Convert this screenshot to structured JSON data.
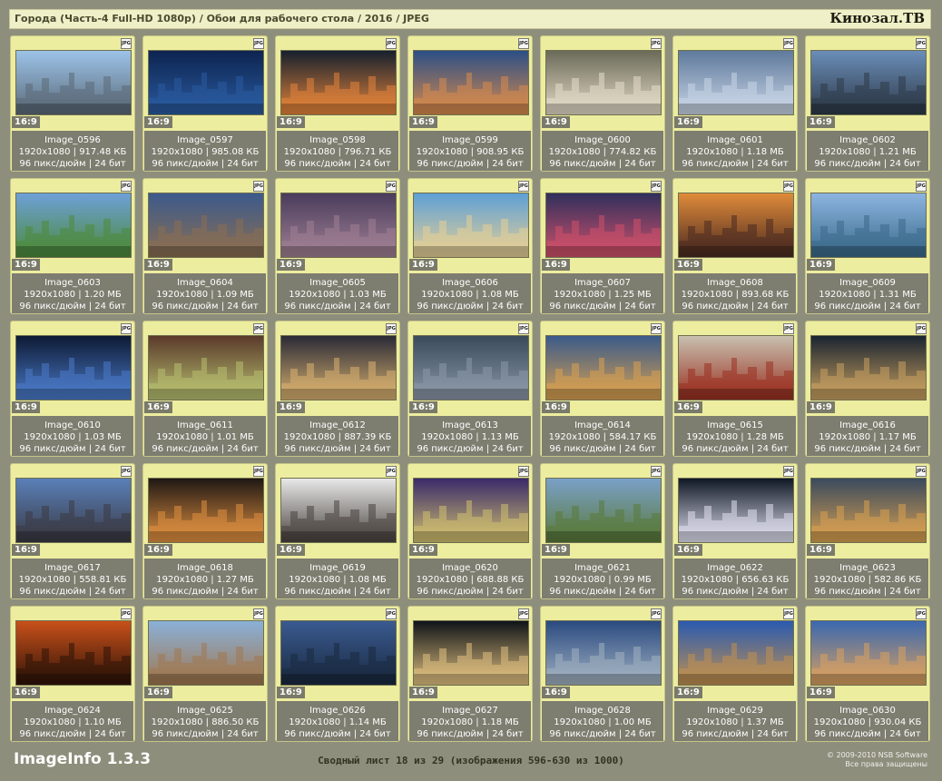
{
  "header": {
    "title": "Города (Часть-4 Full-HD 1080p) / Обои для рабочего стола / 2016 / JPEG",
    "brand": "Кинозал.ТВ"
  },
  "badge_label": "JPG",
  "images": [
    {
      "name": "Image_0596",
      "size": "1920x1080 | 917.48 КБ",
      "dpi": "96 пикс/дюйм | 24 бит",
      "ratio": "16:9",
      "scene": "tower-bridge",
      "colors": [
        "#9cc3e8",
        "#5b6a78"
      ]
    },
    {
      "name": "Image_0597",
      "size": "1920x1080 | 985.08 КБ",
      "dpi": "96 пикс/дюйм | 24 бит",
      "ratio": "16:9",
      "scene": "night-city",
      "colors": [
        "#0d2450",
        "#2a5ba0"
      ]
    },
    {
      "name": "Image_0598",
      "size": "1920x1080 | 796.71 КБ",
      "dpi": "96 пикс/дюйм | 24 бит",
      "ratio": "16:9",
      "scene": "night-bridge",
      "colors": [
        "#16202e",
        "#e4843a"
      ]
    },
    {
      "name": "Image_0599",
      "size": "1920x1080 | 908.95 КБ",
      "dpi": "96 пикс/дюйм | 24 бит",
      "ratio": "16:9",
      "scene": "dusk-skyline",
      "colors": [
        "#2b4f86",
        "#d78a4c"
      ]
    },
    {
      "name": "Image_0600",
      "size": "1920x1080 | 774.82 КБ",
      "dpi": "96 пикс/дюйм | 24 бит",
      "ratio": "16:9",
      "scene": "taj-mahal",
      "colors": [
        "#6b6a58",
        "#e4dcc8"
      ]
    },
    {
      "name": "Image_0601",
      "size": "1920x1080 | 1.18 МБ",
      "dpi": "96 пикс/дюйм | 24 бит",
      "ratio": "16:9",
      "scene": "harbor-bridge",
      "colors": [
        "#5f7a9c",
        "#c9d5e6"
      ]
    },
    {
      "name": "Image_0602",
      "size": "1920x1080 | 1.21 МБ",
      "dpi": "96 пикс/дюйм | 24 бит",
      "ratio": "16:9",
      "scene": "skyscrapers",
      "colors": [
        "#6a8db8",
        "#2e3a48"
      ]
    },
    {
      "name": "Image_0603",
      "size": "1920x1080 | 1.20 МБ",
      "dpi": "96 пикс/дюйм | 24 бит",
      "ratio": "16:9",
      "scene": "lake-city",
      "colors": [
        "#6ea0d8",
        "#4c8a3a"
      ]
    },
    {
      "name": "Image_0604",
      "size": "1920x1080 | 1.09 МБ",
      "dpi": "96 пикс/дюйм | 24 бит",
      "ratio": "16:9",
      "scene": "bay-mountains",
      "colors": [
        "#3c5a8c",
        "#8a6e52"
      ]
    },
    {
      "name": "Image_0605",
      "size": "1920x1080 | 1.03 МБ",
      "dpi": "96 пикс/дюйм | 24 бит",
      "ratio": "16:9",
      "scene": "purple-skyline",
      "colors": [
        "#4a3c5c",
        "#a08094"
      ]
    },
    {
      "name": "Image_0606",
      "size": "1920x1080 | 1.08 МБ",
      "dpi": "96 пикс/дюйм | 24 бит",
      "ratio": "16:9",
      "scene": "beach",
      "colors": [
        "#5ea0d6",
        "#e6cf96"
      ]
    },
    {
      "name": "Image_0607",
      "size": "1920x1080 | 1.25 МБ",
      "dpi": "96 пикс/дюйм | 24 бит",
      "ratio": "16:9",
      "scene": "harbor-night",
      "colors": [
        "#30305c",
        "#d0506a"
      ]
    },
    {
      "name": "Image_0608",
      "size": "1920x1080 | 893.68 КБ",
      "dpi": "96 пикс/дюйм | 24 бит",
      "ratio": "16:9",
      "scene": "sunset-city",
      "colors": [
        "#e08b3a",
        "#4a2a20"
      ]
    },
    {
      "name": "Image_0609",
      "size": "1920x1080 | 1.31 МБ",
      "dpi": "96 пикс/дюйм | 24 бит",
      "ratio": "16:9",
      "scene": "waterfront",
      "colors": [
        "#8cb4e0",
        "#3a6a8a"
      ]
    },
    {
      "name": "Image_0610",
      "size": "1920x1080 | 1.03 МБ",
      "dpi": "96 пикс/дюйм | 24 бит",
      "ratio": "16:9",
      "scene": "night-bridge-blue",
      "colors": [
        "#0e1a34",
        "#4a7ac8"
      ]
    },
    {
      "name": "Image_0611",
      "size": "1920x1080 | 1.01 МБ",
      "dpi": "96 пикс/дюйм | 24 бит",
      "ratio": "16:9",
      "scene": "chinese-garden",
      "colors": [
        "#5a3a2a",
        "#b8c070"
      ]
    },
    {
      "name": "Image_0612",
      "size": "1920x1080 | 887.39 КБ",
      "dpi": "96 пикс/дюйм | 24 бит",
      "ratio": "16:9",
      "scene": "plaza-night",
      "colors": [
        "#2a2a36",
        "#d8b070"
      ]
    },
    {
      "name": "Image_0613",
      "size": "1920x1080 | 1.13 МБ",
      "dpi": "96 пикс/дюйм | 24 бит",
      "ratio": "16:9",
      "scene": "dark-towers",
      "colors": [
        "#3a4a5a",
        "#8a98a8"
      ]
    },
    {
      "name": "Image_0614",
      "size": "1920x1080 | 584.17 КБ",
      "dpi": "96 пикс/дюйм | 24 бит",
      "ratio": "16:9",
      "scene": "drawbridge",
      "colors": [
        "#3a5a8a",
        "#d8a050"
      ]
    },
    {
      "name": "Image_0615",
      "size": "1920x1080 | 1.28 МБ",
      "dpi": "96 пикс/дюйм | 24 бит",
      "ratio": "16:9",
      "scene": "cathedral",
      "colors": [
        "#c8c0b0",
        "#9a3020"
      ]
    },
    {
      "name": "Image_0616",
      "size": "1920x1080 | 1.17 МБ",
      "dpi": "96 пикс/дюйм | 24 бит",
      "ratio": "16:9",
      "scene": "aerial-night",
      "colors": [
        "#1a2430",
        "#c8a060"
      ]
    },
    {
      "name": "Image_0617",
      "size": "1920x1080 | 558.81 КБ",
      "dpi": "96 пикс/дюйм | 24 бит",
      "ratio": "16:9",
      "scene": "flatiron",
      "colors": [
        "#5a80b8",
        "#3a3a44"
      ]
    },
    {
      "name": "Image_0618",
      "size": "1920x1080 | 1.27 МБ",
      "dpi": "96 пикс/дюйм | 24 бит",
      "ratio": "16:9",
      "scene": "street-night",
      "colors": [
        "#201814",
        "#e09040"
      ]
    },
    {
      "name": "Image_0619",
      "size": "1920x1080 | 1.08 МБ",
      "dpi": "96 пикс/дюйм | 24 бит",
      "ratio": "16:9",
      "scene": "colosseum",
      "colors": [
        "#e8e8e8",
        "#4a4440"
      ]
    },
    {
      "name": "Image_0620",
      "size": "1920x1080 | 688.88 КБ",
      "dpi": "96 пикс/дюйм | 24 бит",
      "ratio": "16:9",
      "scene": "tower-bridge-night",
      "colors": [
        "#3a2a6a",
        "#d0c070"
      ]
    },
    {
      "name": "Image_0621",
      "size": "1920x1080 | 0.99 МБ",
      "dpi": "96 пикс/дюйм | 24 бит",
      "ratio": "16:9",
      "scene": "village-clouds",
      "colors": [
        "#7aa0c8",
        "#5a7a3a"
      ]
    },
    {
      "name": "Image_0622",
      "size": "1920x1080 | 656.63 КБ",
      "dpi": "96 пикс/дюйм | 24 бит",
      "ratio": "16:9",
      "scene": "opera-night",
      "colors": [
        "#101826",
        "#e0e0f0"
      ]
    },
    {
      "name": "Image_0623",
      "size": "1920x1080 | 582.86 КБ",
      "dpi": "96 пикс/дюйм | 24 бит",
      "ratio": "16:9",
      "scene": "house-night",
      "colors": [
        "#3a4a5e",
        "#d8a050"
      ]
    },
    {
      "name": "Image_0624",
      "size": "1920x1080 | 1.10 МБ",
      "dpi": "96 пикс/дюйм | 24 бит",
      "ratio": "16:9",
      "scene": "orange-night",
      "colors": [
        "#c8501a",
        "#301408"
      ]
    },
    {
      "name": "Image_0625",
      "size": "1920x1080 | 886.50 КБ",
      "dpi": "96 пикс/дюйм | 24 бит",
      "ratio": "16:9",
      "scene": "las-vegas",
      "colors": [
        "#8ab0d8",
        "#a07850"
      ]
    },
    {
      "name": "Image_0626",
      "size": "1920x1080 | 1.14 МБ",
      "dpi": "96 пикс/дюйм | 24 бит",
      "ratio": "16:9",
      "scene": "blue-skyline",
      "colors": [
        "#3a5a90",
        "#1a2a40"
      ]
    },
    {
      "name": "Image_0627",
      "size": "1920x1080 | 1.18 МБ",
      "dpi": "96 пикс/дюйм | 24 бит",
      "ratio": "16:9",
      "scene": "highway-night",
      "colors": [
        "#101418",
        "#e0c080"
      ]
    },
    {
      "name": "Image_0628",
      "size": "1920x1080 | 1.00 МБ",
      "dpi": "96 пикс/дюйм | 24 бит",
      "ratio": "16:9",
      "scene": "interchange",
      "colors": [
        "#2a4a80",
        "#a0b0c0"
      ]
    },
    {
      "name": "Image_0629",
      "size": "1920x1080 | 1.37 МБ",
      "dpi": "96 пикс/дюйм | 24 бит",
      "ratio": "16:9",
      "scene": "palace-blue",
      "colors": [
        "#2a5ab0",
        "#c09050"
      ]
    },
    {
      "name": "Image_0630",
      "size": "1920x1080 | 930.04 КБ",
      "dpi": "96 пикс/дюйм | 24 бит",
      "ratio": "16:9",
      "scene": "eiffel",
      "colors": [
        "#3a68b0",
        "#d8a060"
      ]
    }
  ],
  "footer": {
    "app_name": "ImageInfo 1.3.3",
    "summary": "Сводный лист 18 из 29 (изображения 596-630 из 1000)",
    "copyright_line1": "© 2009-2010 NSB Software",
    "copyright_line2": "Все права защищены"
  }
}
